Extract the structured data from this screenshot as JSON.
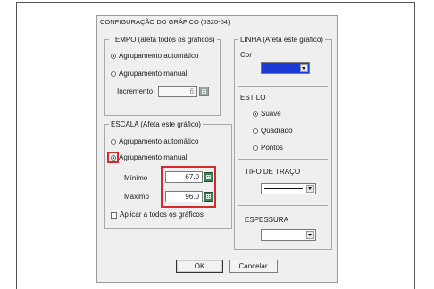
{
  "dialog": {
    "title": "CONFIGURAÇÃO DO GRÁFICO (5320-04)"
  },
  "tempo": {
    "legend": "TEMPO (afeta todos os gráficos)",
    "auto_label": "Agrupamento automático",
    "manual_label": "Agrupamento manual",
    "selected": "auto",
    "increment_label": "Incremento",
    "increment_value": "6"
  },
  "escala": {
    "legend": "ESCALA (Afeta este gráfico)",
    "auto_label": "Agrupamento automático",
    "manual_label": "Agrupamento manual",
    "selected": "manual",
    "min_label": "Mínimo",
    "min_value": "67.0",
    "max_label": "Máximo",
    "max_value": "96.0",
    "apply_all_label": "Aplicar a todos os gráficos",
    "apply_all_checked": false
  },
  "linha": {
    "legend": "LINHA (Afeta este gráfico)",
    "color_label": "Cor",
    "color_value": "#1b3bd6",
    "estilo_label": "ESTILO",
    "estilo_options": [
      "Suave",
      "Quadrado",
      "Pontos"
    ],
    "estilo_selected": "Suave",
    "tipo_label": "TIPO DE TRAÇO",
    "espessura_label": "ESPESSURA"
  },
  "buttons": {
    "ok": "OK",
    "cancel": "Cancelar"
  },
  "colors": {
    "highlight": "#d42a2a",
    "calculator_icon": "#3c7f52"
  }
}
